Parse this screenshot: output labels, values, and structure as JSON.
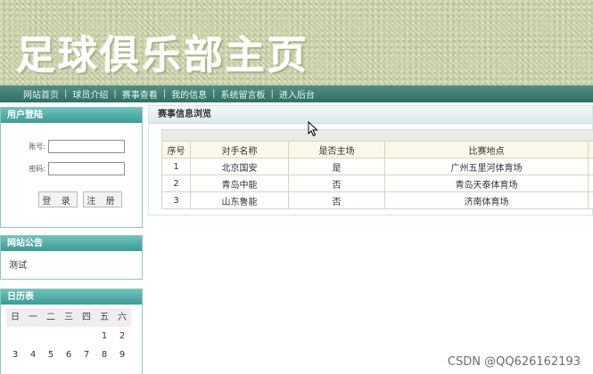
{
  "site_title": "足球俱乐部主页",
  "nav": {
    "items": [
      "网站首页",
      "球员介绍",
      "赛事查看",
      "我的信息",
      "系统留言板",
      "进入后台"
    ],
    "separator": "|"
  },
  "login": {
    "title": "用户登陆",
    "account_label": "账号:",
    "password_label": "密码:",
    "account_value": "",
    "password_value": "",
    "login_button": "登 录",
    "register_button": "注 册"
  },
  "notice": {
    "title": "网站公告",
    "text": "测试"
  },
  "calendar": {
    "title": "日历表",
    "weekdays": [
      "日",
      "一",
      "二",
      "三",
      "四",
      "五",
      "六"
    ],
    "days": [
      "",
      "",
      "",
      "",
      "",
      "1",
      "2",
      "3",
      "4",
      "5",
      "6",
      "7",
      "8",
      "9"
    ]
  },
  "matches": {
    "title": "赛事信息浏览",
    "columns": [
      "序号",
      "对手名称",
      "是否主场",
      "比赛地点"
    ],
    "rows": [
      [
        "1",
        "北京国安",
        "是",
        "广州五里河体育场"
      ],
      [
        "2",
        "青岛中能",
        "否",
        "青岛天泰体育场"
      ],
      [
        "3",
        "山东鲁能",
        "否",
        "济南体育场"
      ]
    ]
  },
  "watermark": "CSDN @QQ626162193",
  "colors": {
    "nav_bg": "#3f7f76",
    "panel_head": "#4aa8a1",
    "banner_bg": "#c9d3a8"
  }
}
